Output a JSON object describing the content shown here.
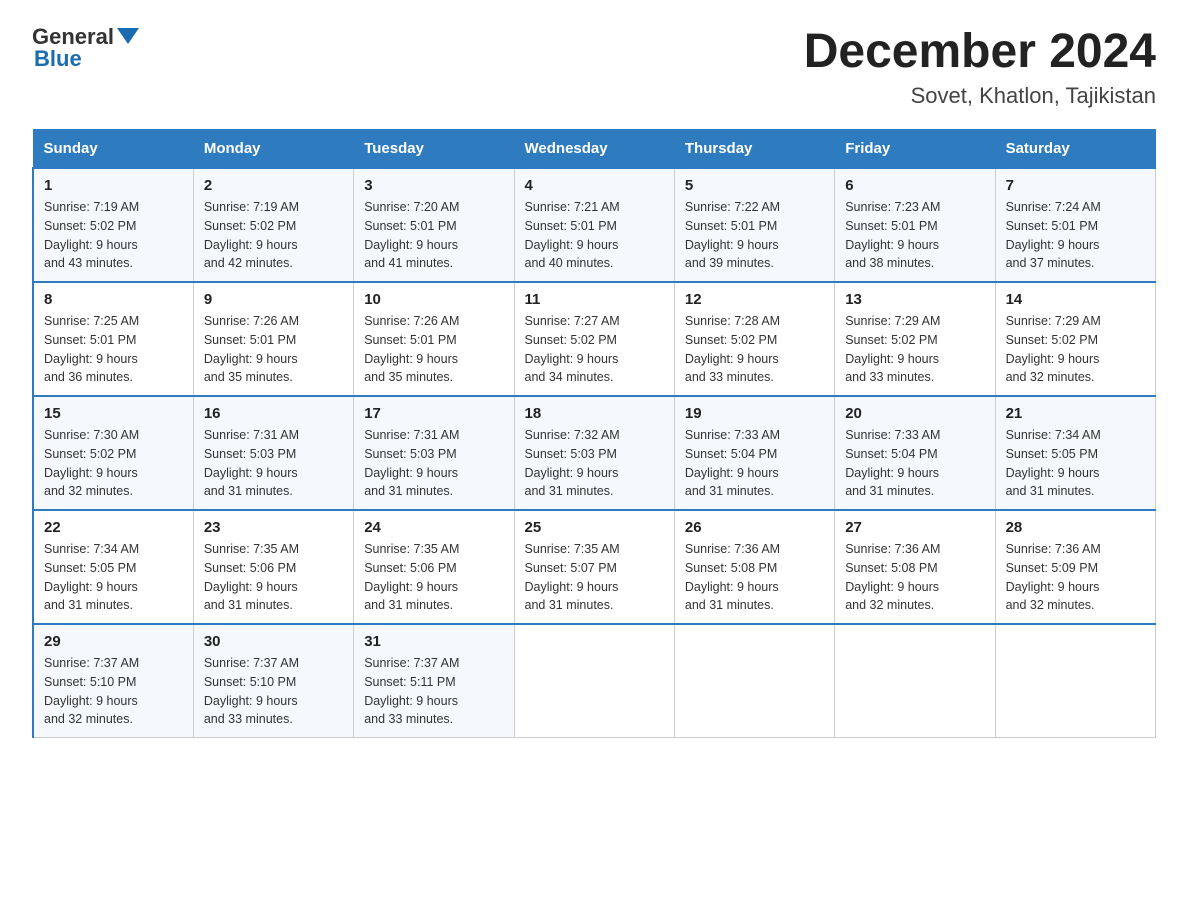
{
  "header": {
    "logo_general": "General",
    "logo_blue": "Blue",
    "month_title": "December 2024",
    "location": "Sovet, Khatlon, Tajikistan"
  },
  "days_of_week": [
    "Sunday",
    "Monday",
    "Tuesday",
    "Wednesday",
    "Thursday",
    "Friday",
    "Saturday"
  ],
  "weeks": [
    [
      {
        "day": "1",
        "sunrise": "7:19 AM",
        "sunset": "5:02 PM",
        "daylight": "9 hours and 43 minutes."
      },
      {
        "day": "2",
        "sunrise": "7:19 AM",
        "sunset": "5:02 PM",
        "daylight": "9 hours and 42 minutes."
      },
      {
        "day": "3",
        "sunrise": "7:20 AM",
        "sunset": "5:01 PM",
        "daylight": "9 hours and 41 minutes."
      },
      {
        "day": "4",
        "sunrise": "7:21 AM",
        "sunset": "5:01 PM",
        "daylight": "9 hours and 40 minutes."
      },
      {
        "day": "5",
        "sunrise": "7:22 AM",
        "sunset": "5:01 PM",
        "daylight": "9 hours and 39 minutes."
      },
      {
        "day": "6",
        "sunrise": "7:23 AM",
        "sunset": "5:01 PM",
        "daylight": "9 hours and 38 minutes."
      },
      {
        "day": "7",
        "sunrise": "7:24 AM",
        "sunset": "5:01 PM",
        "daylight": "9 hours and 37 minutes."
      }
    ],
    [
      {
        "day": "8",
        "sunrise": "7:25 AM",
        "sunset": "5:01 PM",
        "daylight": "9 hours and 36 minutes."
      },
      {
        "day": "9",
        "sunrise": "7:26 AM",
        "sunset": "5:01 PM",
        "daylight": "9 hours and 35 minutes."
      },
      {
        "day": "10",
        "sunrise": "7:26 AM",
        "sunset": "5:01 PM",
        "daylight": "9 hours and 35 minutes."
      },
      {
        "day": "11",
        "sunrise": "7:27 AM",
        "sunset": "5:02 PM",
        "daylight": "9 hours and 34 minutes."
      },
      {
        "day": "12",
        "sunrise": "7:28 AM",
        "sunset": "5:02 PM",
        "daylight": "9 hours and 33 minutes."
      },
      {
        "day": "13",
        "sunrise": "7:29 AM",
        "sunset": "5:02 PM",
        "daylight": "9 hours and 33 minutes."
      },
      {
        "day": "14",
        "sunrise": "7:29 AM",
        "sunset": "5:02 PM",
        "daylight": "9 hours and 32 minutes."
      }
    ],
    [
      {
        "day": "15",
        "sunrise": "7:30 AM",
        "sunset": "5:02 PM",
        "daylight": "9 hours and 32 minutes."
      },
      {
        "day": "16",
        "sunrise": "7:31 AM",
        "sunset": "5:03 PM",
        "daylight": "9 hours and 31 minutes."
      },
      {
        "day": "17",
        "sunrise": "7:31 AM",
        "sunset": "5:03 PM",
        "daylight": "9 hours and 31 minutes."
      },
      {
        "day": "18",
        "sunrise": "7:32 AM",
        "sunset": "5:03 PM",
        "daylight": "9 hours and 31 minutes."
      },
      {
        "day": "19",
        "sunrise": "7:33 AM",
        "sunset": "5:04 PM",
        "daylight": "9 hours and 31 minutes."
      },
      {
        "day": "20",
        "sunrise": "7:33 AM",
        "sunset": "5:04 PM",
        "daylight": "9 hours and 31 minutes."
      },
      {
        "day": "21",
        "sunrise": "7:34 AM",
        "sunset": "5:05 PM",
        "daylight": "9 hours and 31 minutes."
      }
    ],
    [
      {
        "day": "22",
        "sunrise": "7:34 AM",
        "sunset": "5:05 PM",
        "daylight": "9 hours and 31 minutes."
      },
      {
        "day": "23",
        "sunrise": "7:35 AM",
        "sunset": "5:06 PM",
        "daylight": "9 hours and 31 minutes."
      },
      {
        "day": "24",
        "sunrise": "7:35 AM",
        "sunset": "5:06 PM",
        "daylight": "9 hours and 31 minutes."
      },
      {
        "day": "25",
        "sunrise": "7:35 AM",
        "sunset": "5:07 PM",
        "daylight": "9 hours and 31 minutes."
      },
      {
        "day": "26",
        "sunrise": "7:36 AM",
        "sunset": "5:08 PM",
        "daylight": "9 hours and 31 minutes."
      },
      {
        "day": "27",
        "sunrise": "7:36 AM",
        "sunset": "5:08 PM",
        "daylight": "9 hours and 32 minutes."
      },
      {
        "day": "28",
        "sunrise": "7:36 AM",
        "sunset": "5:09 PM",
        "daylight": "9 hours and 32 minutes."
      }
    ],
    [
      {
        "day": "29",
        "sunrise": "7:37 AM",
        "sunset": "5:10 PM",
        "daylight": "9 hours and 32 minutes."
      },
      {
        "day": "30",
        "sunrise": "7:37 AM",
        "sunset": "5:10 PM",
        "daylight": "9 hours and 33 minutes."
      },
      {
        "day": "31",
        "sunrise": "7:37 AM",
        "sunset": "5:11 PM",
        "daylight": "9 hours and 33 minutes."
      },
      null,
      null,
      null,
      null
    ]
  ],
  "labels": {
    "sunrise": "Sunrise:",
    "sunset": "Sunset:",
    "daylight": "Daylight:"
  }
}
